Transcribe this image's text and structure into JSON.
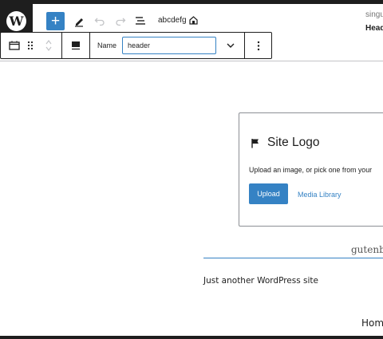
{
  "header": {
    "add_label": "+",
    "doc_title": "abcdefg",
    "template_right": "singu",
    "template_part_right": "Head"
  },
  "block_toolbar": {
    "name_label": "Name",
    "name_value": "header"
  },
  "site_logo": {
    "title": "Site Logo",
    "description": "Upload an image, or pick one from your",
    "upload_label": "Upload",
    "media_library_label": "Media Library"
  },
  "site": {
    "title": "gutenb",
    "tagline": "Just another WordPress site",
    "nav_home": "Hom"
  },
  "colors": {
    "accent": "#3582c4",
    "dark": "#1e1e1e"
  },
  "icons": [
    "wordpress-logo-icon",
    "plus-icon",
    "pencil-icon",
    "undo-icon",
    "redo-icon",
    "list-view-icon",
    "home-icon",
    "header-block-icon",
    "drag-handle-icon",
    "move-up-icon",
    "move-down-icon",
    "align-icon",
    "chevron-down-icon",
    "more-options-icon",
    "flag-icon"
  ]
}
